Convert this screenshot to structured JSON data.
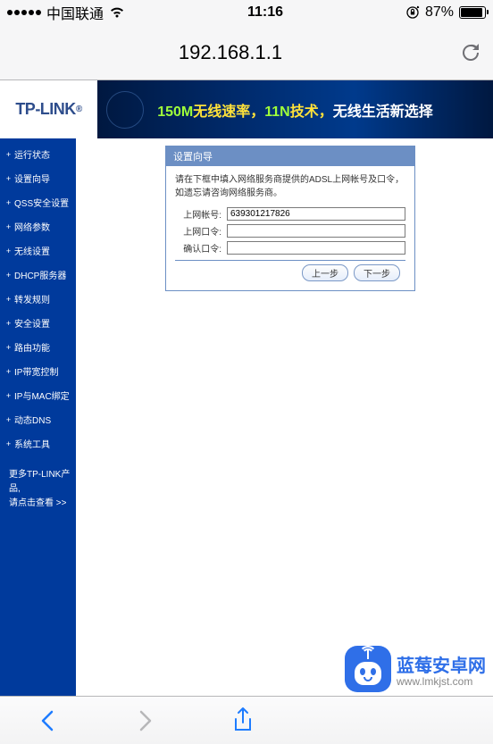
{
  "status": {
    "carrier": "中国联通",
    "time": "11:16",
    "battery_pct": "87%"
  },
  "browser": {
    "url": "192.168.1.1"
  },
  "router": {
    "brand": "TP-LINK",
    "banner_parts": {
      "speed_val": "150M",
      "speed_txt": "无线速率，",
      "tech_val": "11N",
      "tech_txt": "技术，",
      "slogan": "无线生活新选择"
    },
    "nav": [
      "运行状态",
      "设置向导",
      "QSS安全设置",
      "网络参数",
      "无线设置",
      "DHCP服务器",
      "转发规则",
      "安全设置",
      "路由功能",
      "IP带宽控制",
      "IP与MAC绑定",
      "动态DNS",
      "系统工具"
    ],
    "more": {
      "line1": "更多TP-LINK产品,",
      "line2": "请点击查看 ",
      "arrows": ">>"
    },
    "panel": {
      "title": "设置向导",
      "hint": "请在下框中填入网络服务商提供的ADSL上网帐号及口令，如遗忘请咨询网络服务商。",
      "fields": {
        "account_label": "上网帐号:",
        "account_value": "639301217826",
        "password_label": "上网口令:",
        "confirm_label": "确认口令:"
      },
      "buttons": {
        "prev": "上一步",
        "next": "下一步"
      }
    }
  },
  "watermark": {
    "title": "蓝莓安卓网",
    "url": "www.lmkjst.com"
  }
}
